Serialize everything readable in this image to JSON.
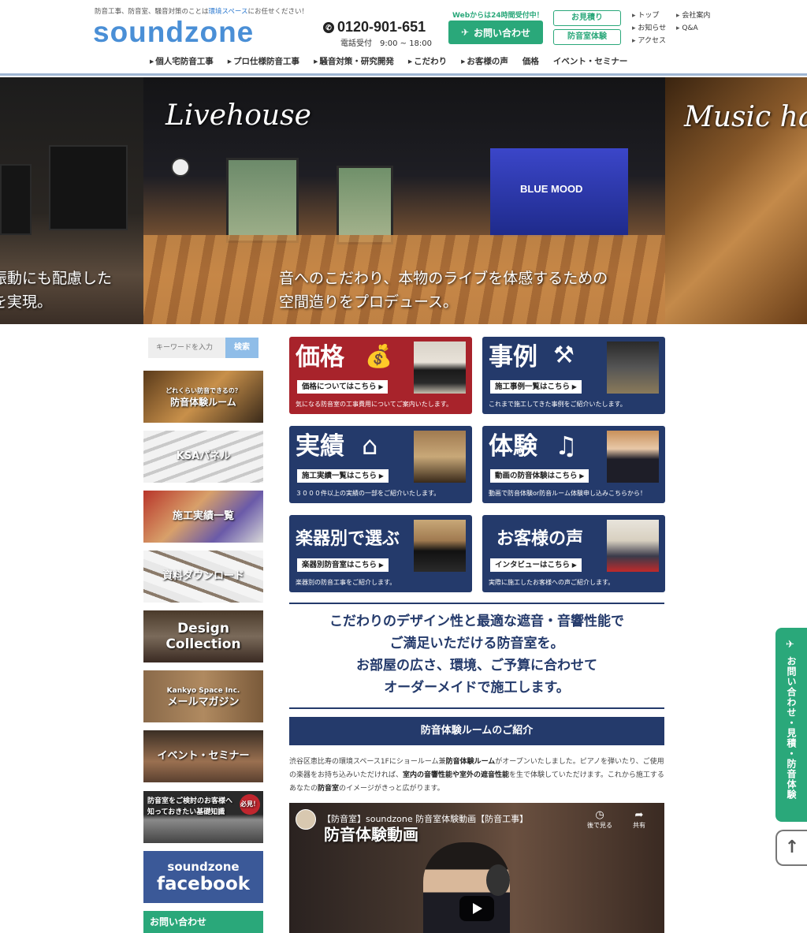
{
  "header": {
    "tagline_pre": "防音工事、防音室、騒音対策のことは",
    "tagline_link": "環境スペース",
    "tagline_post": "にお任せください！",
    "logo": "soundzone",
    "phone": "0120-901-651",
    "phone_hours": "電話受付　9:00 ~ 18:00",
    "web_note": "Webからは24時間受付中！",
    "contact_label": "お問い合わせ",
    "estimate_label": "お見積り",
    "experience_label": "防音室体験",
    "util_col1": [
      "トップ",
      "お知らせ",
      "アクセス"
    ],
    "util_col2": [
      "会社案内",
      "Q&A"
    ]
  },
  "nav": [
    "個人宅防音工事",
    "プロ仕様防音工事",
    "騒音対策・研究開発",
    "こだわり",
    "お客様の声",
    "価格",
    "イベント・セミナー"
  ],
  "hero": {
    "left_text_1": "振動にも配慮した",
    "left_text_2": "を実現。",
    "title": "Livehouse",
    "stage_label": "BLUE MOOD",
    "text_1": "音へのこだわり、本物のライブを体感するための",
    "text_2": "空間造りをプロデュース。",
    "right_title": "Music ha"
  },
  "sidebar": {
    "search_placeholder": "キーワードを入力",
    "search_button": "検索",
    "banners": [
      {
        "small": "どれくらい防音できるの？",
        "label": "防音体験ルーム"
      },
      {
        "small": "",
        "label": "KSAパネル"
      },
      {
        "small": "",
        "label": "施工実績一覧"
      },
      {
        "small": "",
        "label": "資料ダウンロード"
      },
      {
        "small": "",
        "label": "Design Collection"
      },
      {
        "small": "Kankyo Space Inc.",
        "label": "メールマガジン"
      },
      {
        "small": "",
        "label": "イベント・セミナー"
      },
      {
        "small": "防音室をご検討のお客様へ 知っておきたい基礎知識",
        "label": "必見！"
      },
      {
        "small": "soundzone",
        "label": "facebook"
      },
      {
        "small": "",
        "label": "お問い合わせ"
      }
    ]
  },
  "tiles": [
    {
      "title": "価格",
      "link": "価格についてはこちら",
      "desc": "気になる防音室の工事費用についてご案内いたします。"
    },
    {
      "title": "事例",
      "link": "施工事例一覧はこちら",
      "desc": "これまで施工してきた事例をご紹介いたします。"
    },
    {
      "title": "実績",
      "link": "施工実績一覧はこちら",
      "desc": "３０００件以上の実績の一部をご紹介いたします。"
    },
    {
      "title": "体験",
      "link": "動画の防音体験はこちら",
      "desc": "動画で防音体験or防音ルーム体験申し込みこちらから！"
    },
    {
      "title": "楽器別で選ぶ",
      "link": "楽器別防音室はこちら",
      "desc": "楽器別の防音工事をご紹介します。"
    },
    {
      "title": "お客様の声",
      "link": "インタビューはこちら",
      "desc": "実際に施工したお客様への声ご紹介します。"
    }
  ],
  "message": {
    "line1": "こだわりのデザイン性と最適な遮音・音響性能で",
    "line2": "ご満足いただける防音室を。",
    "line3": "お部屋の広さ、環境、ご予算に合わせて",
    "line4": "オーダーメイドで施工します。"
  },
  "section": {
    "heading": "防音体験ルームのご紹介",
    "body_1": "渋谷区恵比寿の環境スペース1Fにショールーム兼",
    "body_b1": "防音体験ルーム",
    "body_2": "がオープンいたしました。ピアノを弾いたり、ご",
    "body_3": "使用の楽器をお持ち込みいただければ、",
    "body_b2": "室内の音響性能や室外の遮音性能",
    "body_4": "を生で体験していただけます。これから",
    "body_5": "施工するあなたの",
    "body_b3": "防音室",
    "body_6": "のイメージがきっと広がります。"
  },
  "video": {
    "title": "【防音室】soundzone 防音室体験動画【防音工事】",
    "overlay": "防音体験動画",
    "watch_later": "後で見る",
    "share": "共有"
  },
  "floating": {
    "label": "お問い合わせ・見積・防音体験",
    "top_arrow": "↑"
  },
  "colors": {
    "accent_green": "#2aa87a",
    "brand_blue": "#4a8fd6",
    "navy": "#243a6b",
    "red": "#a8232b"
  }
}
